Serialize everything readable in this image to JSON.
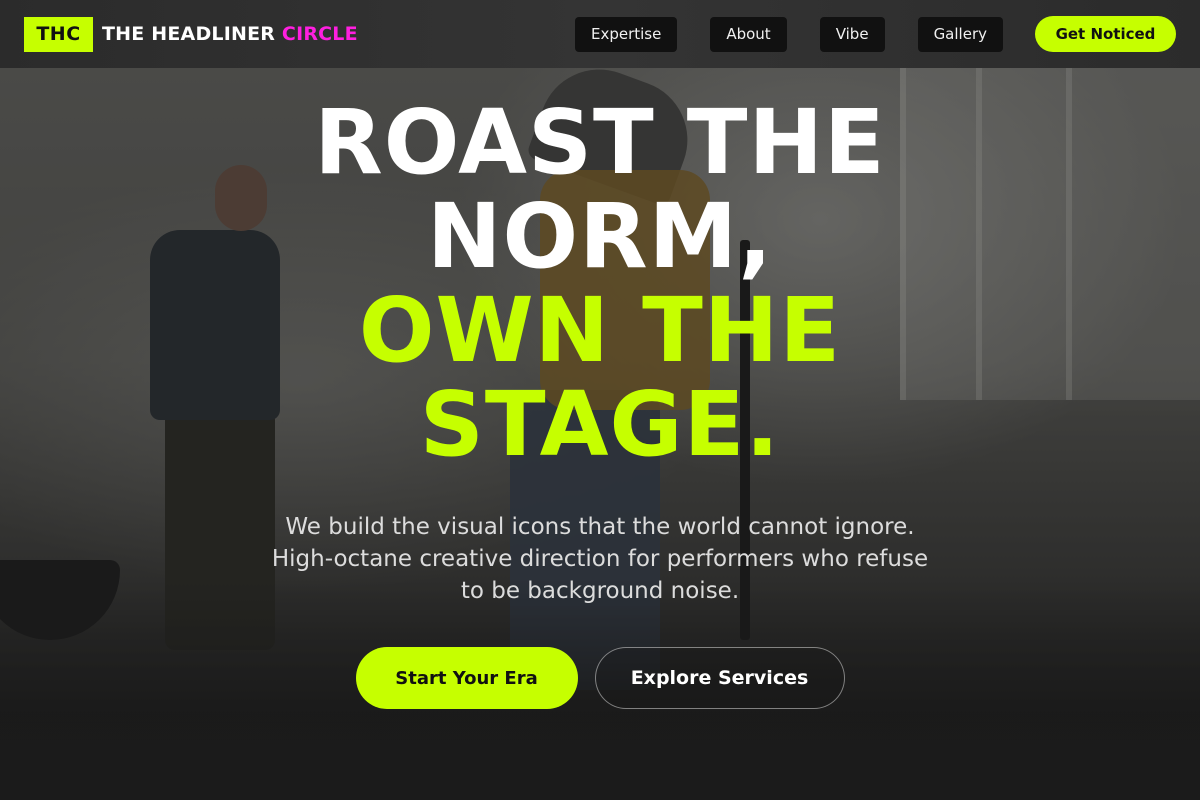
{
  "brand": {
    "badge": "THC",
    "name_main": "THE HEADLINER ",
    "name_accent": "CIRCLE"
  },
  "nav": {
    "items": [
      {
        "label": "Expertise"
      },
      {
        "label": "About"
      },
      {
        "label": "Vibe"
      },
      {
        "label": "Gallery"
      }
    ],
    "cta_label": "Get Noticed"
  },
  "hero": {
    "headline_lines": [
      "ROAST THE",
      "NORM,",
      "OWN THE",
      "STAGE."
    ],
    "subtext": "We build the visual icons that the world cannot ignore. High-octane creative direction for performers who refuse to be background noise.",
    "primary_button": "Start Your Era",
    "secondary_button": "Explore Services"
  },
  "colors": {
    "accent": "#c6ff00",
    "brand_accent": "#ff1fe0",
    "header_bg": "#2e2e2e",
    "nav_button_bg": "#111111"
  }
}
